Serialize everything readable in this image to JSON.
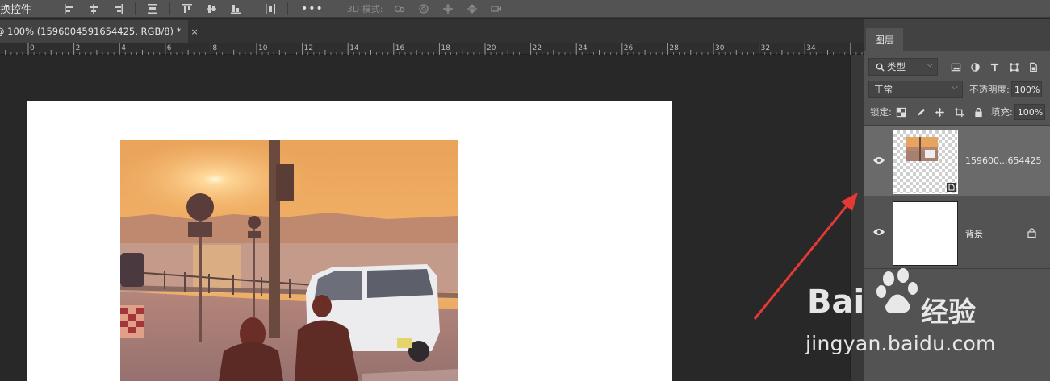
{
  "optbar": {
    "label": "换控件",
    "mode3d": "3D 模式:",
    "more": "•••"
  },
  "doc_tab": {
    "title": "@ 100% (1596004591654425, RGB/8) *",
    "close": "×"
  },
  "ruler": {
    "labels": [
      "0",
      "2",
      "4",
      "6",
      "8",
      "10",
      "12",
      "14",
      "16",
      "18",
      "20",
      "22",
      "24",
      "26",
      "28",
      "30",
      "32",
      "34"
    ]
  },
  "panel": {
    "tab_layers": "图层",
    "filter_kind": "类型",
    "blend_mode": "正常",
    "opacity_label": "不透明度:",
    "opacity_value": "100%",
    "lock_label": "锁定:",
    "fill_label": "填充:",
    "fill_value": "100%"
  },
  "layers": [
    {
      "name": "159600...654425",
      "visible": true,
      "active": true,
      "type": "smart-object"
    },
    {
      "name": "背景",
      "visible": true,
      "active": false,
      "locked": true
    }
  ],
  "watermark": {
    "brand": "Bai",
    "cn": "经验",
    "url": "jingyan.baidu.com"
  },
  "colors": {
    "annotation_arrow": "#e53935",
    "panel_bg": "#535353",
    "canvas_bg": "#282828"
  }
}
